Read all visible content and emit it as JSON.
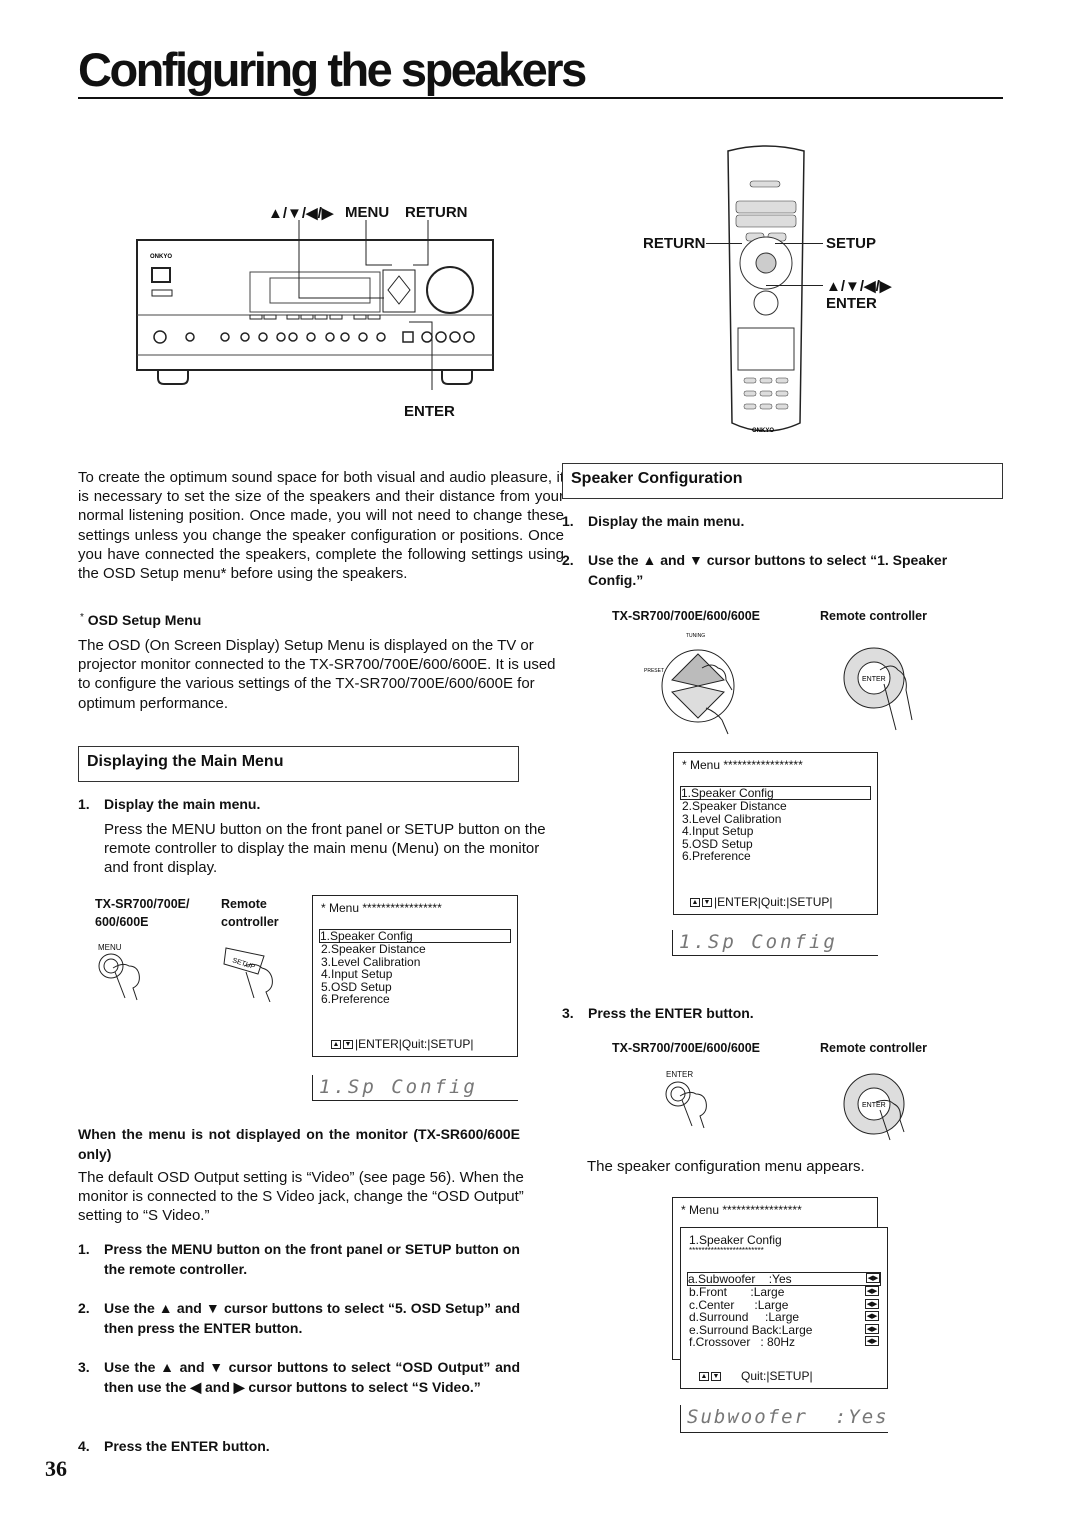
{
  "page": {
    "title": "Configuring the speakers",
    "number": "36"
  },
  "receiver_diagram": {
    "label_arrows": "▲/▼/◀/▶",
    "label_menu": "MENU",
    "label_return": "RETURN",
    "label_enter": "ENTER",
    "brand": "ONKYO"
  },
  "remote_diagram": {
    "label_return": "RETURN",
    "label_setup": "SETUP",
    "label_arrows": "▲/▼/◀/▶",
    "label_enter": "ENTER",
    "brand": "ONKYO"
  },
  "intro": {
    "text": "To create the optimum sound space for both visual and audio pleasure, it is necessary to set the size of the speakers and their distance from your normal listening position. Once made, you will not need to change these settings unless you change the speaker configuration or positions. Once you have connected the speakers, complete the following settings using the OSD Setup menu* before using the speakers.",
    "footnote_mark": "*",
    "footnote_title": "OSD Setup Menu",
    "footnote_text": "The OSD (On Screen Display) Setup Menu is displayed on the TV or projector monitor connected to the TX-SR700/700E/600/600E. It is used to configure the various settings of the TX-SR700/700E/600/600E for optimum performance."
  },
  "displaying_main_menu": {
    "heading": "Displaying the Main Menu",
    "step1_num": "1.",
    "step1": "Display the main menu.",
    "step1_text": "Press the MENU button on the front panel or SETUP button on the remote controller to display the main menu (Menu) on the monitor and front display.",
    "caption_unit": "TX-SR700/700E/ 600/600E",
    "caption_remote": "Remote controller",
    "button_menu": "MENU",
    "button_setup": "SETUP",
    "lcd": "1.Sp Config"
  },
  "main_menu": {
    "header": "* Menu *****************",
    "items": [
      "1.Speaker Config",
      "2.Speaker Distance",
      "3.Level Calibration",
      "4.Input Setup",
      "5.OSD Setup",
      "6.Preference"
    ],
    "footer": "|ENTER|Quit:|SETUP|"
  },
  "not_displayed": {
    "heading": "When the menu is not displayed on the monitor (TX-SR600/600E only)",
    "text": "The default OSD Output setting is “Video” (see page 56). When the monitor is connected to the S Video jack, change the “OSD Output” setting to “S Video.”",
    "steps": [
      {
        "num": "1.",
        "text": "Press the MENU button on the front panel or SETUP button on the remote controller."
      },
      {
        "num": "2.",
        "text": "Use the ▲ and ▼ cursor buttons to select “5. OSD Setup” and then press the ENTER button."
      },
      {
        "num": "3.",
        "text": "Use the ▲ and ▼ cursor buttons to select “OSD Output” and then use the ◀ and ▶ cursor buttons to select “S Video.”"
      },
      {
        "num": "4.",
        "text": "Press the ENTER button."
      }
    ]
  },
  "speaker_configuration": {
    "heading": "Speaker Configuration",
    "steps": [
      {
        "num": "1.",
        "text": "Display the main menu."
      },
      {
        "num": "2.",
        "text": "Use the ▲ and ▼ cursor buttons to select “1. Speaker Config.”"
      },
      {
        "num": "3.",
        "text": "Press the ENTER button."
      }
    ],
    "caption_unit": "TX-SR700/700E/600/600E",
    "caption_remote": "Remote controller",
    "knob_tuning": "TUNING",
    "knob_preset": "PRESET",
    "button_enter": "ENTER",
    "lcd1": "1.Sp Config",
    "appears_text": "The speaker configuration menu appears.",
    "lcd2": "Subwoofer  :Yes"
  },
  "config_menu": {
    "header": "* Menu *****************",
    "title": "1.Speaker Config",
    "stars": "************************",
    "items": [
      "a.Subwoofer    :Yes",
      "b.Front       :Large",
      "c.Center      :Large",
      "d.Surround     :Large",
      "e.Surround Back:Large",
      "f.Crossover   : 80Hz"
    ],
    "footer": "Quit:|SETUP|"
  }
}
